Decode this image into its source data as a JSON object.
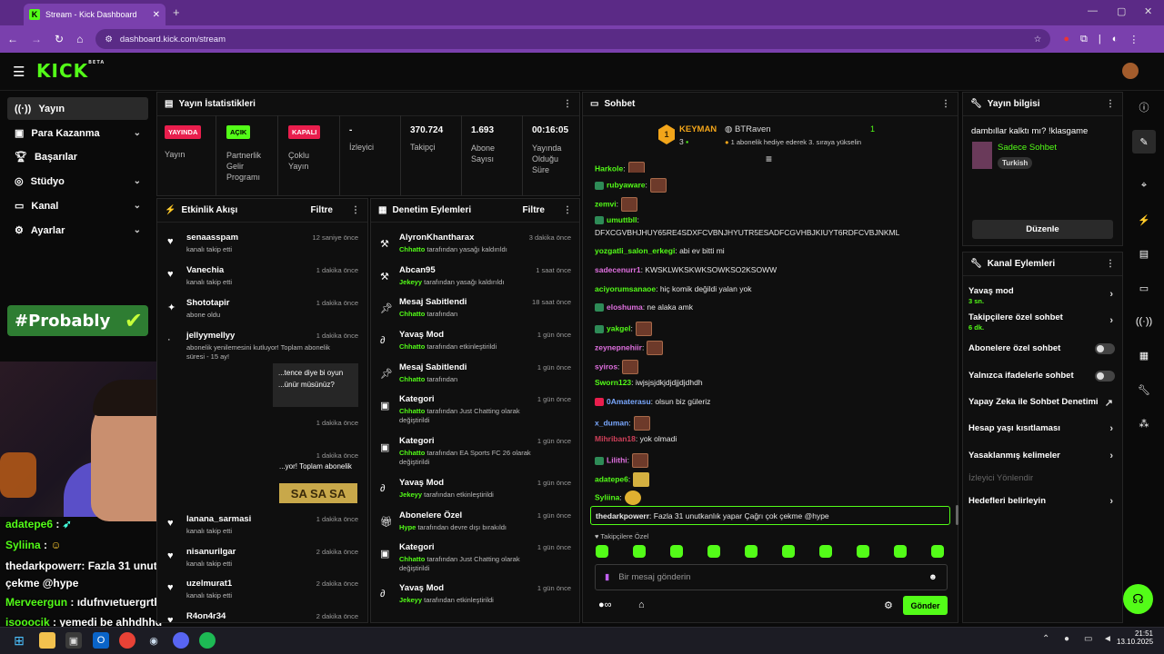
{
  "browser": {
    "tab_title": "Stream - Kick Dashboard",
    "new_tab": "+",
    "url": "dashboard.kick.com/stream"
  },
  "app": {
    "logo": "KICK",
    "logo_sup": "BETA"
  },
  "sidebar": {
    "items": [
      {
        "label": "Yayın",
        "icon": "stream-icon"
      },
      {
        "label": "Para Kazanma",
        "icon": "money-icon"
      },
      {
        "label": "Başarılar",
        "icon": "trophy-icon"
      },
      {
        "label": "Stüdyo",
        "icon": "studio-icon"
      },
      {
        "label": "Kanal",
        "icon": "channel-icon"
      },
      {
        "label": "Ayarlar",
        "icon": "settings-icon"
      }
    ],
    "banner": "#Probably"
  },
  "overlay_chat": [
    {
      "user": "adatepe6",
      "text": ":"
    },
    {
      "user": "Syliina",
      "text": ":"
    },
    {
      "user": "thedarkpowerr",
      "text": ": Fazla 31 unutkanlık yapar Çağrı çok"
    },
    {
      "user": "",
      "text": "çekme @hype"
    },
    {
      "user": "Merveergun",
      "text": ": ıdufnvıetuergrthuıtrhgh"
    },
    {
      "user": "isooocik",
      "text": ": yemedi be ahhdhhd"
    }
  ],
  "stats": {
    "title": "Yayın İstatistikleri",
    "items": [
      {
        "badge": "YAYINDA",
        "label": "Yayın"
      },
      {
        "badge": "AÇIK",
        "label": "Partnerlik Gelir Programı"
      },
      {
        "badge": "KAPALI",
        "label": "Çoklu Yayın"
      },
      {
        "value": "-",
        "label": "İzleyici"
      },
      {
        "value": "370.724",
        "label": "Takipçi"
      },
      {
        "value": "1.693",
        "label": "Abone Sayısı"
      },
      {
        "value": "00:16:05",
        "label": "Yayında Olduğu Süre"
      }
    ]
  },
  "activity": {
    "title": "Etkinlik Akışı",
    "filter": "Filtre",
    "items": [
      {
        "name": "senaasspam",
        "sub": "kanalı takip etti",
        "time": "12 saniye önce"
      },
      {
        "name": "Vanechia",
        "sub": "kanalı takip etti",
        "time": "1 dakika önce"
      },
      {
        "name": "Shototapir",
        "sub": "abone oldu",
        "time": "1 dakika önce"
      },
      {
        "name": "jellyymellyy",
        "sub": "abonelik yenilemesini kutluyor! Toplam abonelik süresi - 15 ay!",
        "time": "1 dakika önce"
      },
      {
        "name": "",
        "sub": "",
        "time": "1 dakika önce"
      },
      {
        "name": "",
        "sub": "",
        "time": "1 dakika önce"
      },
      {
        "name": "lanana_sarmasi",
        "sub": "kanalı takip etti",
        "time": "1 dakika önce"
      },
      {
        "name": "nisanurilgar",
        "sub": "kanalı takip etti",
        "time": "2 dakika önce"
      },
      {
        "name": "uzelmurat1",
        "sub": "kanalı takip etti",
        "time": "2 dakika önce"
      },
      {
        "name": "R4on4r34",
        "sub": "",
        "time": "2 dakika önce"
      }
    ],
    "highlight": "...tence diye bi oyun ...ünür müsünüz?",
    "highlight2": "...yor! Toplam abonelik"
  },
  "moderation": {
    "title": "Denetim Eylemleri",
    "filter": "Filtre",
    "items": [
      {
        "name": "AlyronKhantharax",
        "by": "Chhatto",
        "sub": "tarafından yasağı kaldırıldı",
        "time": "3 dakika önce"
      },
      {
        "name": "Abcan95",
        "by": "Jekeyy",
        "sub": "tarafından yasağı kaldırıldı",
        "time": "1 saat önce"
      },
      {
        "name": "Mesaj Sabitlendi",
        "by": "Chhatto",
        "sub": "tarafından",
        "time": "18 saat önce"
      },
      {
        "name": "Yavaş Mod",
        "by": "Chhatto",
        "sub": "tarafından etkinleştirildi",
        "time": "1 gün önce"
      },
      {
        "name": "Mesaj Sabitlendi",
        "by": "Chhatto",
        "sub": "tarafından",
        "time": "1 gün önce"
      },
      {
        "name": "Kategori",
        "by": "Chhatto",
        "sub": "tarafından Just Chatting olarak değiştirildi",
        "time": "1 gün önce"
      },
      {
        "name": "Kategori",
        "by": "Chhatto",
        "sub": "tarafından EA Sports FC 26 olarak değiştirildi",
        "time": "1 gün önce"
      },
      {
        "name": "Yavaş Mod",
        "by": "Jekeyy",
        "sub": "tarafından etkinleştirildi",
        "time": "1 gün önce"
      },
      {
        "name": "Abonelere Özel",
        "by": "Hype",
        "sub": "tarafından devre dışı bırakıldı",
        "time": "1 gün önce"
      },
      {
        "name": "Kategori",
        "by": "Chhatto",
        "sub": "tarafından Just Chatting olarak değiştirildi",
        "time": "1 gün önce"
      },
      {
        "name": "Yavaş Mod",
        "by": "Jekeyy",
        "sub": "tarafından etkinleştirildi",
        "time": "1 gün önce"
      }
    ]
  },
  "chat": {
    "title": "Sohbet",
    "leader_name": "KEYMAN",
    "leader_count": "3",
    "rank": "1",
    "runner_name": "BTRaven",
    "runner_count": "1",
    "runner_sub": "1 abonelik hediye ederek 3. sıraya yükselin",
    "messages": [
      {
        "user": "Harkole",
        "color": "#53fc18",
        "text": ":"
      },
      {
        "user": "rubyaware",
        "color": "#53fc18",
        "text": ":"
      },
      {
        "user": "zemvi",
        "color": "#53fc18",
        "text": ":"
      },
      {
        "user": "umuttbll",
        "color": "#53fc18",
        "text": ":"
      },
      {
        "user": "",
        "color": "#e8e8e8",
        "text": "DFXCGVBHJHUY65RE4SDXFCVBNJHYUTR5ESADFCGVHBJKIUYT6RDFCVBJNKML"
      },
      {
        "user": "yozgatli_salon_erkegi",
        "color": "#53fc18",
        "text": ": abi ev bitti mi"
      },
      {
        "user": "sadecenurr1",
        "color": "#e070e0",
        "text": ": KWSKLWKSKWKSOWKSO2KSOWW"
      },
      {
        "user": "aciyorumsanaoe",
        "color": "#53fc18",
        "text": ": hiç komik değildi yalan yok"
      },
      {
        "user": "eloshuma",
        "color": "#e070e0",
        "text": ": ne alaka amk"
      },
      {
        "user": "yakgel",
        "color": "#53fc18",
        "text": ":"
      },
      {
        "user": "zeynepnehiir",
        "color": "#e070e0",
        "text": ":"
      },
      {
        "user": "syiros",
        "color": "#e070e0",
        "text": ":"
      },
      {
        "user": "Sworn123",
        "color": "#53fc18",
        "text": ": iwjsjsjdkjdjdjjdjdhdh"
      },
      {
        "user": "0Amaterasu",
        "color": "#7aa8ff",
        "text": ": olsun biz güleriz"
      },
      {
        "user": "x_duman",
        "color": "#7aa8ff",
        "text": ":"
      },
      {
        "user": "Mihriban18",
        "color": "#d0405a",
        "text": ": yok olmadi"
      },
      {
        "user": "Lilithi",
        "color": "#e070e0",
        "text": ":"
      },
      {
        "user": "adatepe6",
        "color": "#53fc18",
        "text": ":"
      },
      {
        "user": "Syliina",
        "color": "#53fc18",
        "text": ":"
      }
    ],
    "pinned_user": "thedarkpowerr",
    "pinned_text": ": Fazla 31 unutkanlık yapar Çağrı çok çekme @hype",
    "follower_only": "Takipçilere Özel",
    "placeholder": "Bir mesaj gönderin",
    "send": "Gönder"
  },
  "stream_info": {
    "title": "Yayın bilgisi",
    "stream_title": "dambıllar kalktı mı? !klasgame",
    "category": "Sadece Sohbet",
    "tag": "Turkish",
    "edit": "Düzenle"
  },
  "channel_actions": {
    "title": "Kanal Eylemleri",
    "items": [
      {
        "label": "Yavaş mod",
        "sub": "3 sn.",
        "control": "chevron"
      },
      {
        "label": "Takipçilere özel sohbet",
        "sub": "6 dk.",
        "control": "chevron"
      },
      {
        "label": "Abonelere özel sohbet",
        "sub": "",
        "control": "toggle"
      },
      {
        "label": "Yalnızca ifadelerle sohbet",
        "sub": "",
        "control": "toggle"
      },
      {
        "label": "Yapay Zeka ile Sohbet Denetimi",
        "sub": "",
        "control": "external"
      },
      {
        "label": "Hesap yaşı kısıtlaması",
        "sub": "",
        "control": "chevron"
      },
      {
        "label": "Yasaklanmış kelimeler",
        "sub": "",
        "control": "chevron"
      },
      {
        "label": "İzleyici Yönlendir",
        "sub": "",
        "control": "none"
      },
      {
        "label": "Hedefleri belirleyin",
        "sub": "",
        "control": "chevron"
      }
    ]
  },
  "taskbar": {
    "time": "21:51",
    "date": "13.10.2025"
  },
  "colors": {
    "accent": "#53fc18",
    "browser": "#7a40ad",
    "live": "#e91e4d"
  }
}
